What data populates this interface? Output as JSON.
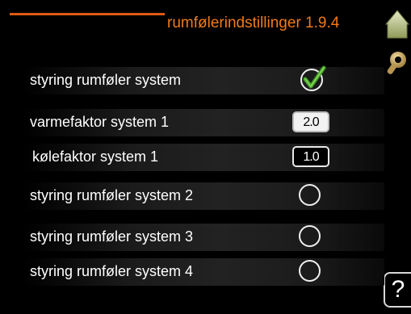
{
  "header": {
    "title": "rumfølerindstillinger 1.9.4",
    "accent_color": "#f07a1a",
    "line_color": "#e05a10"
  },
  "icons": {
    "home": "home-icon",
    "settings": "wrench-icon",
    "help": "help-icon",
    "help_glyph": "?"
  },
  "rows": [
    {
      "label": "styring rumføler system",
      "control": "checkbox",
      "checked": true
    },
    {
      "label": "varmefaktor system 1",
      "control": "value",
      "value": "2.0"
    },
    {
      "label": "kølefaktor system 1",
      "control": "value",
      "value": "1.0"
    },
    {
      "label": "styring rumføler system 2",
      "control": "radio",
      "checked": false
    },
    {
      "label": "styring rumføler system 3",
      "control": "radio",
      "checked": false
    },
    {
      "label": "styring rumføler system 4",
      "control": "radio",
      "checked": false
    }
  ]
}
